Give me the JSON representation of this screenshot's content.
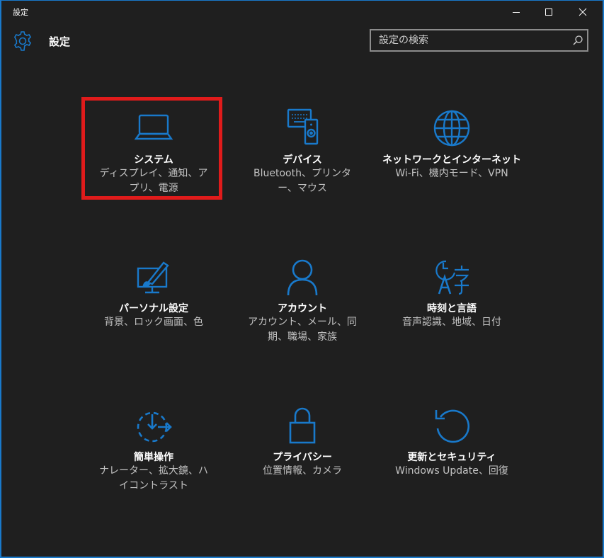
{
  "window": {
    "title": "設定",
    "buttons": {
      "minimize": "minimize-icon",
      "maximize": "maximize-icon",
      "close": "close-icon"
    }
  },
  "header": {
    "title": "設定",
    "icon": "gear-icon"
  },
  "search": {
    "placeholder": "設定の検索",
    "value": "",
    "icon": "search-icon"
  },
  "accent_color": "#1979ca",
  "highlight_color": "#e01b1b",
  "tiles": [
    {
      "name": "システム",
      "desc": "ディスプレイ、通知、アプリ、電源",
      "icon": "laptop-icon"
    },
    {
      "name": "デバイス",
      "desc": "Bluetooth、プリンター、マウス",
      "icon": "devices-icon"
    },
    {
      "name": "ネットワークとインターネット",
      "desc": "Wi-Fi、機内モード、VPN",
      "icon": "globe-icon"
    },
    {
      "name": "パーソナル設定",
      "desc": "背景、ロック画面、色",
      "icon": "personalization-icon"
    },
    {
      "name": "アカウント",
      "desc": "アカウント、メール、同期、職場、家族",
      "icon": "person-icon"
    },
    {
      "name": "時刻と言語",
      "desc": "音声認識、地域、日付",
      "icon": "time-language-icon"
    },
    {
      "name": "簡単操作",
      "desc": "ナレーター、拡大鏡、ハイコントラスト",
      "icon": "ease-of-access-icon"
    },
    {
      "name": "プライバシー",
      "desc": "位置情報、カメラ",
      "icon": "lock-icon"
    },
    {
      "name": "更新とセキュリティ",
      "desc": "Windows Update、回復",
      "icon": "update-icon"
    }
  ]
}
